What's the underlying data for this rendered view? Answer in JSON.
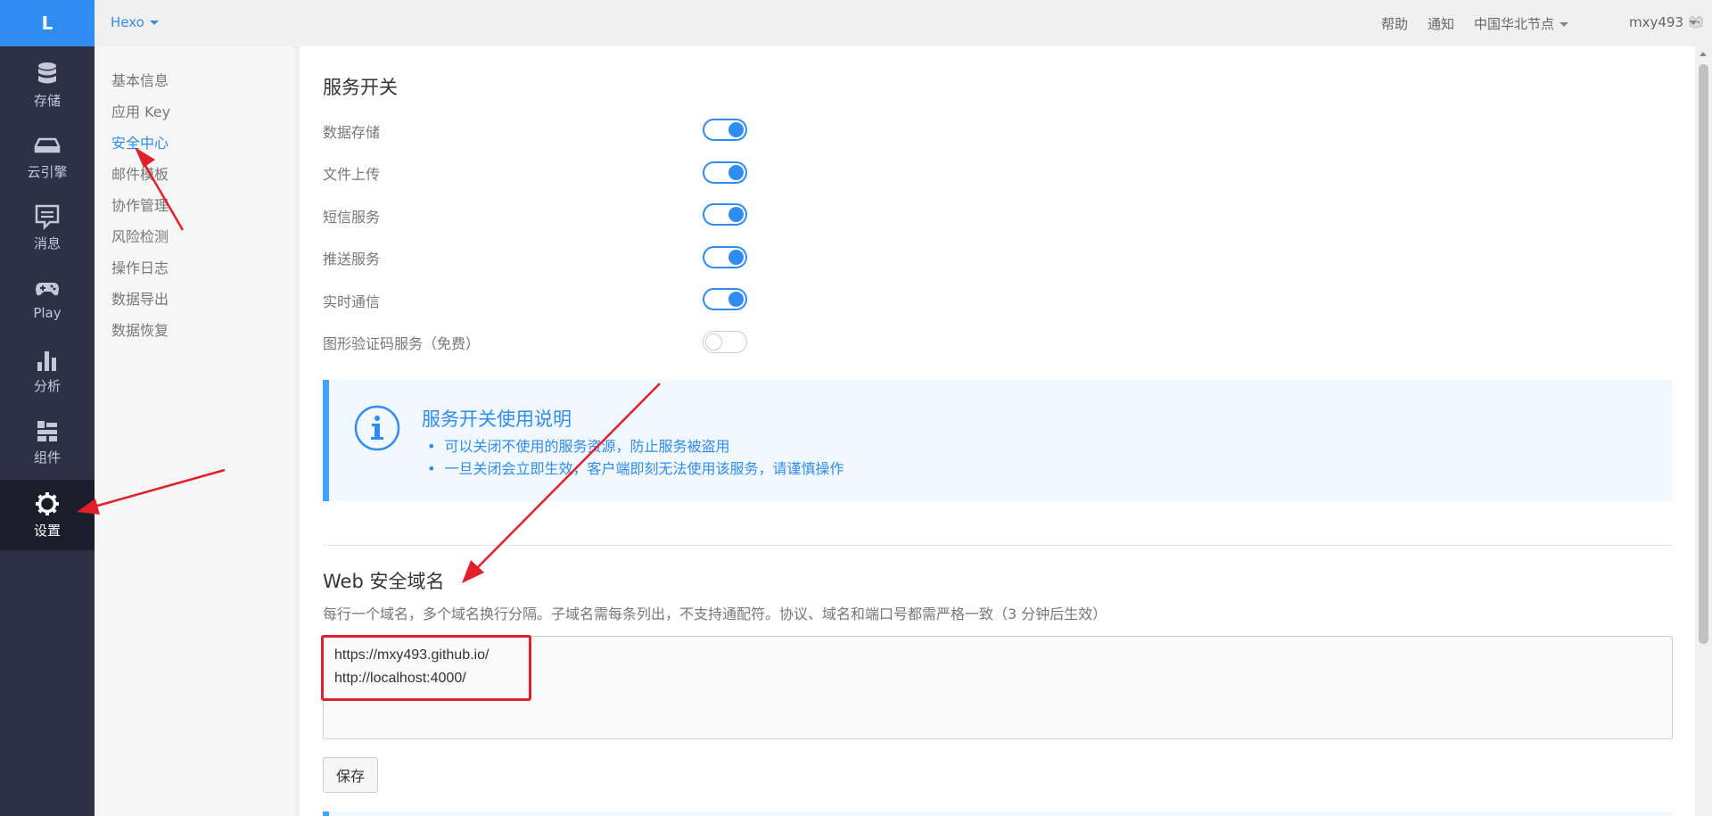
{
  "logo": "L",
  "nav": {
    "items": [
      {
        "label": "存储",
        "icon": "database-icon"
      },
      {
        "label": "云引擎",
        "icon": "server-icon"
      },
      {
        "label": "消息",
        "icon": "message-icon"
      },
      {
        "label": "Play",
        "icon": "gamepad-icon"
      },
      {
        "label": "分析",
        "icon": "bar-chart-icon"
      },
      {
        "label": "组件",
        "icon": "components-icon"
      },
      {
        "label": "设置",
        "icon": "gear-icon"
      }
    ],
    "active": "设置"
  },
  "topbar": {
    "app_name": "Hexo",
    "links": [
      "帮助",
      "通知"
    ],
    "region": "中国华北节点",
    "user": "mxy493"
  },
  "subnav": {
    "items": [
      "基本信息",
      "应用 Key",
      "安全中心",
      "邮件模板",
      "协作管理",
      "风险检测",
      "操作日志",
      "数据导出",
      "数据恢复"
    ],
    "active": "安全中心"
  },
  "services": {
    "title": "服务开关",
    "items": [
      {
        "label": "数据存储",
        "enabled": true
      },
      {
        "label": "文件上传",
        "enabled": true
      },
      {
        "label": "短信服务",
        "enabled": true
      },
      {
        "label": "推送服务",
        "enabled": true
      },
      {
        "label": "实时通信",
        "enabled": true
      },
      {
        "label": "图形验证码服务（免费）",
        "enabled": false
      }
    ]
  },
  "notice": {
    "title": "服务开关使用说明",
    "items": [
      "可以关闭不使用的服务资源，防止服务被盗用",
      "一旦关闭会立即生效，客户端即刻无法使用该服务，请谨慎操作"
    ]
  },
  "web_domains": {
    "title": "Web 安全域名",
    "description": "每行一个域名，多个域名换行分隔。子域名需每条列出，不支持通配符。协议、域名和端口号都需严格一致（3 分钟后生效）",
    "value": "https://mxy493.github.io/\nhttp://localhost:4000/",
    "save_label": "保存"
  },
  "colors": {
    "accent": "#2f8cf0",
    "nav_bg": "#2e3145",
    "annotation": "#e0202a"
  }
}
